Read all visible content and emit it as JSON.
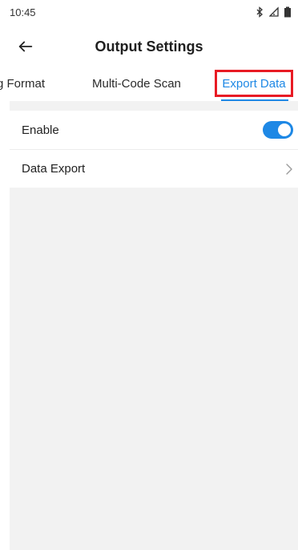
{
  "status_bar": {
    "time": "10:45",
    "icons": [
      "bluetooth-icon",
      "signal-icon",
      "battery-icon"
    ]
  },
  "app_bar": {
    "title": "Output Settings",
    "back_icon": "back-arrow-icon"
  },
  "tabs": [
    {
      "label": "g Format",
      "selected": false
    },
    {
      "label": "Multi-Code Scan",
      "selected": false
    },
    {
      "label": "Export Data",
      "selected": true
    }
  ],
  "settings": {
    "enable": {
      "label": "Enable",
      "toggle_on": true
    },
    "data_export": {
      "label": "Data Export",
      "icon": "chevron-right-icon"
    }
  },
  "colors": {
    "accent": "#1e88e5",
    "highlight_box": "#e81b24",
    "background": "#f2f2f2",
    "surface": "#ffffff"
  }
}
